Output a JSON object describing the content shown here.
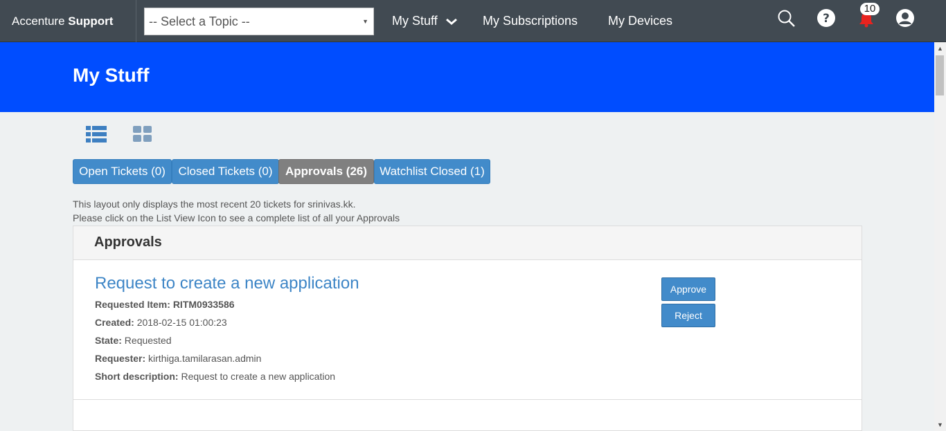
{
  "nav": {
    "brand_light": "Accenture",
    "brand_bold": "Support",
    "topic_select": "-- Select a Topic --",
    "links": [
      "My Stuff",
      "My Subscriptions",
      "My Devices"
    ],
    "notification_count": "10",
    "icons": [
      "search-icon",
      "help-icon",
      "bell-icon",
      "user-icon"
    ]
  },
  "banner": {
    "title": "My Stuff"
  },
  "colors": {
    "nav_bg": "#414a52",
    "banner_bg": "#004dff",
    "tab_bg": "#428bca",
    "tab_active_bg": "#808080",
    "link": "#3d85c6"
  },
  "tabs": [
    {
      "label": "Open Tickets (0)",
      "active": false
    },
    {
      "label": "Closed Tickets (0)",
      "active": false
    },
    {
      "label": "Approvals (26)",
      "active": true
    },
    {
      "label": "Watchlist Closed (1)",
      "active": false
    }
  ],
  "info": {
    "line1": "This layout only displays the most recent 20 tickets for srinivas.kk.",
    "line2": "Please click on the List View Icon to see a complete list of all your Approvals"
  },
  "panel": {
    "title": "Approvals",
    "item": {
      "title": "Request to create a new application",
      "fields": [
        {
          "label": "Requested Item:",
          "value": "RITM0933586"
        },
        {
          "label": "Created:",
          "value": "2018-02-15 01:00:23"
        },
        {
          "label": "State:",
          "value": "Requested"
        },
        {
          "label": "Requester:",
          "value": "kirthiga.tamilarasan.admin"
        },
        {
          "label": "Short description:",
          "value": "Request to create a new application"
        }
      ],
      "approve_label": "Approve",
      "reject_label": "Reject"
    }
  }
}
